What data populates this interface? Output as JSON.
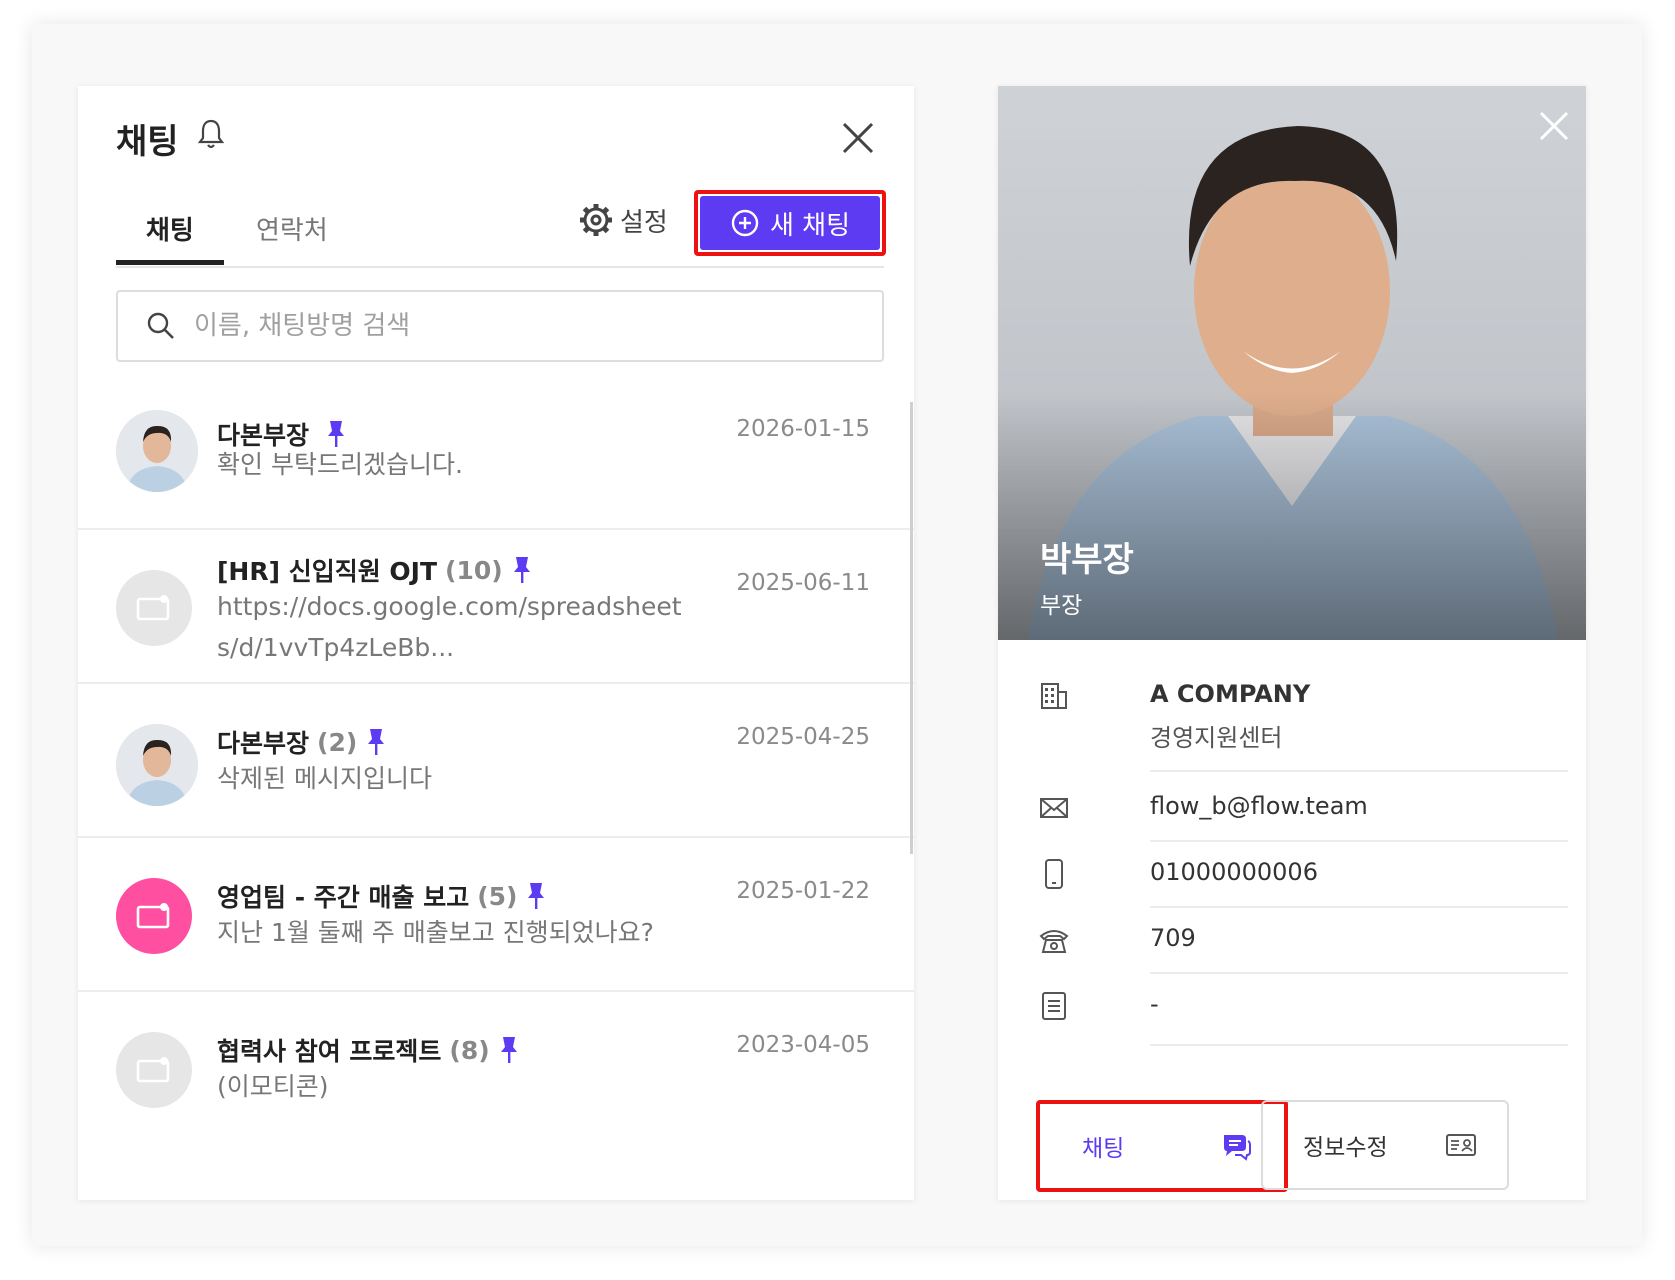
{
  "chat_panel": {
    "title": "채팅",
    "tabs": {
      "chat": "채팅",
      "contacts": "연락처"
    },
    "settings_label": "설정",
    "new_chat_label": "새 채팅",
    "search_placeholder": "이름, 채팅방명 검색",
    "rooms": [
      {
        "name": "다본부장",
        "count": "",
        "pinned": true,
        "date": "2026-01-15",
        "message": "확인 부탁드리겠습니다.",
        "avatar": "photo"
      },
      {
        "name": "[HR] 신입직원 OJT",
        "count": "(10)",
        "pinned": true,
        "date": "2025-06-11",
        "message": "https://docs.google.com/spreadsheets/d/1vvTp4zLeBb...",
        "avatar": "room-gray"
      },
      {
        "name": "다본부장",
        "count": "(2)",
        "pinned": true,
        "date": "2025-04-25",
        "message": "삭제된 메시지입니다",
        "avatar": "photo"
      },
      {
        "name": "영업팀 - 주간 매출 보고",
        "count": "(5)",
        "pinned": true,
        "date": "2025-01-22",
        "message": "지난 1월 둘째 주 매출보고 진행되었나요?",
        "avatar": "room-pink"
      },
      {
        "name": "협력사 참여 프로젝트",
        "count": "(8)",
        "pinned": true,
        "date": "2023-04-05",
        "message": "(이모티콘)",
        "avatar": "room-gray"
      }
    ]
  },
  "profile_panel": {
    "name": "박부장",
    "rank": "부장",
    "company": "A COMPANY",
    "department": "경영지원센터",
    "email": "flow_b@flow.team",
    "mobile": "01000000006",
    "extension": "709",
    "memo": "-",
    "chat_button": "채팅",
    "edit_button": "정보수정"
  },
  "colors": {
    "accent": "#5d3bf3",
    "highlight": "#ee1111",
    "room_pink": "#ff4fa0",
    "room_gray": "#e6e6e6"
  }
}
